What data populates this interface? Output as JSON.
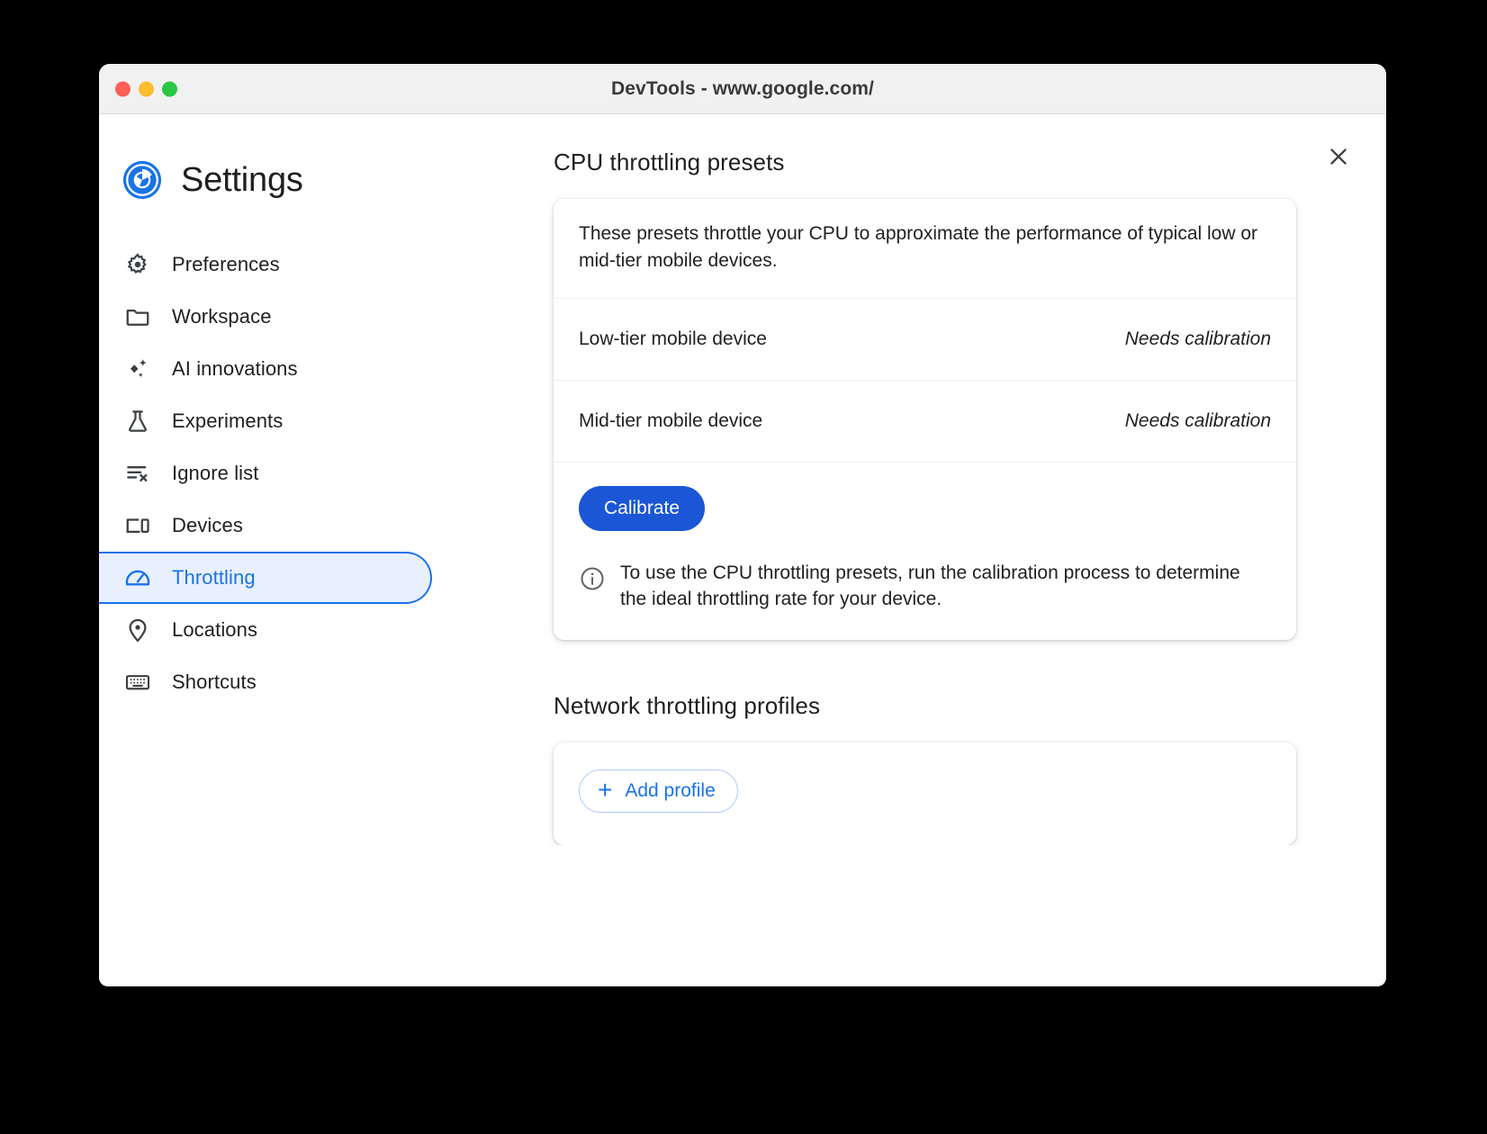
{
  "window": {
    "title": "DevTools - www.google.com/",
    "traffic_lights": [
      "close",
      "minimize",
      "zoom"
    ],
    "colors": {
      "close": "#ff5f57",
      "minimize": "#febc2e",
      "zoom": "#28c840",
      "accent": "#1a73e8",
      "primary_button": "#1a56d6",
      "selected_bg": "#e8f0fe"
    }
  },
  "settings": {
    "brand_title": "Settings",
    "close_label": "Close",
    "sidebar": {
      "items": [
        {
          "label": "Preferences",
          "icon": "gear-icon",
          "selected": false
        },
        {
          "label": "Workspace",
          "icon": "folder-icon",
          "selected": false
        },
        {
          "label": "AI innovations",
          "icon": "sparkle-icon",
          "selected": false
        },
        {
          "label": "Experiments",
          "icon": "flask-icon",
          "selected": false
        },
        {
          "label": "Ignore list",
          "icon": "ignore-list-icon",
          "selected": false
        },
        {
          "label": "Devices",
          "icon": "devices-icon",
          "selected": false
        },
        {
          "label": "Throttling",
          "icon": "speedometer-icon",
          "selected": true
        },
        {
          "label": "Locations",
          "icon": "location-pin-icon",
          "selected": false
        },
        {
          "label": "Shortcuts",
          "icon": "keyboard-icon",
          "selected": false
        }
      ]
    },
    "cpu_presets": {
      "heading": "CPU throttling presets",
      "description": "These presets throttle your CPU to approximate the performance of typical low or mid-tier mobile devices.",
      "rows": [
        {
          "name": "Low-tier mobile device",
          "status": "Needs calibration"
        },
        {
          "name": "Mid-tier mobile device",
          "status": "Needs calibration"
        }
      ],
      "calibrate_label": "Calibrate",
      "info_text": "To use the CPU throttling presets, run the calibration process to determine the ideal throttling rate for your device."
    },
    "network_profiles": {
      "heading": "Network throttling profiles",
      "add_profile_label": "Add profile",
      "add_profile_plus": "+"
    }
  }
}
